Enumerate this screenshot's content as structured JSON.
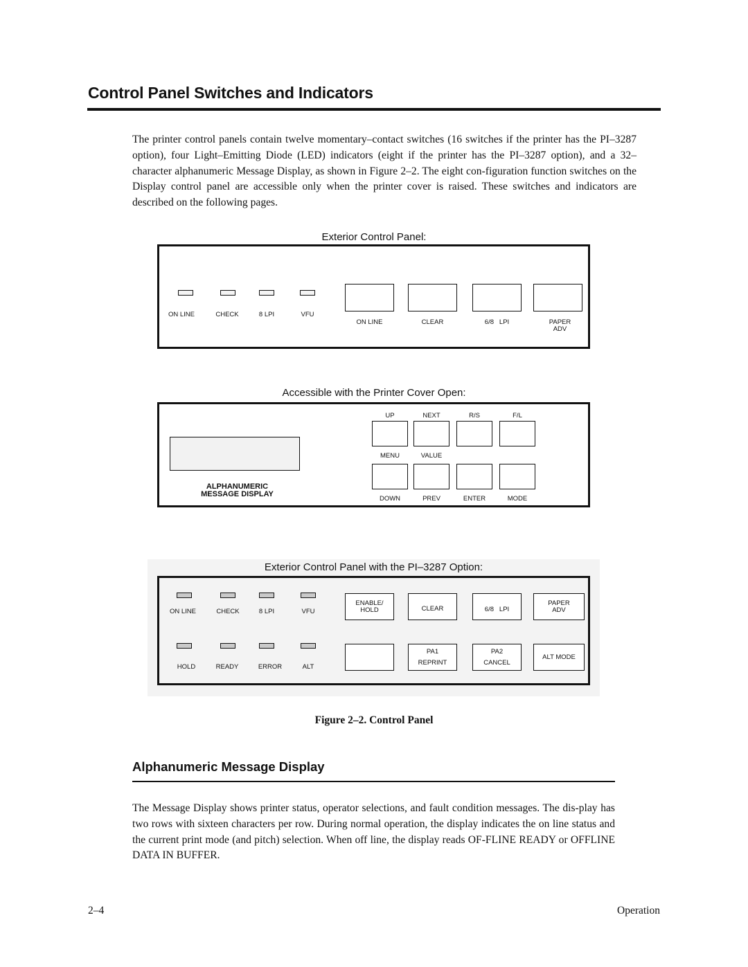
{
  "page": {
    "title": "Control Panel Switches and Indicators",
    "intro": "The printer control panels contain twelve momentary–contact switches (16 switches if the printer has the PI–3287 option), four Light–Emitting Diode (LED) indicators (eight if the printer has the PI–3287 option), and a 32–character alphanumeric Message Display, as shown in Figure 2–2. The eight con-figuration function switches on the Display control panel are accessible only when the printer cover is raised. These switches and indicators are described on the following pages."
  },
  "figure": {
    "caption": "Figure 2–2. Control Panel",
    "panel1": {
      "caption": "Exterior Control Panel:",
      "leds": [
        "ON LINE",
        "CHECK",
        "8 LPI",
        "VFU"
      ],
      "switches": [
        {
          "label": "ON LINE"
        },
        {
          "label": "CLEAR"
        },
        {
          "label": "6/8   LPI"
        },
        {
          "label": "PAPER",
          "label2": "ADV"
        }
      ]
    },
    "panel2": {
      "caption": "Accessible with the Printer Cover Open:",
      "display_label_line1": "ALPHANUMERIC",
      "display_label_line2": "MESSAGE DISPLAY",
      "top_labels": [
        "UP",
        "NEXT",
        "R/S",
        "F/L"
      ],
      "mid_labels": [
        "MENU",
        "VALUE"
      ],
      "bottom_labels": [
        "DOWN",
        "PREV",
        "ENTER",
        "MODE"
      ]
    },
    "panel3": {
      "caption": "Exterior Control Panel with the PI–3287 Option:",
      "leds_row1": [
        "ON LINE",
        "CHECK",
        "8 LPI",
        "VFU"
      ],
      "leds_row2": [
        "HOLD",
        "READY",
        "ERROR",
        "ALT"
      ],
      "switches_row1": [
        {
          "line1": "ENABLE/",
          "line2": "HOLD"
        },
        {
          "line1": "CLEAR"
        },
        {
          "line1": "6/8   LPI"
        },
        {
          "line1": "PAPER",
          "line2": "ADV"
        }
      ],
      "switches_row2": [
        {},
        {
          "line1": "PA1",
          "line2": "REPRINT"
        },
        {
          "line1": "PA2",
          "line2": "CANCEL"
        },
        {
          "line1": "ALT MODE"
        }
      ]
    }
  },
  "section": {
    "title": "Alphanumeric Message Display",
    "body": "The Message Display shows printer status, operator selections, and fault condition messages. The dis-play has two rows with sixteen characters per row. During normal operation, the display indicates the on line status and the current print mode (and pitch) selection. When off line, the display reads OF-FLINE READY or OFFLINE DATA IN BUFFER."
  },
  "footer": {
    "page_number": "2–4",
    "section_name": "Operation"
  }
}
